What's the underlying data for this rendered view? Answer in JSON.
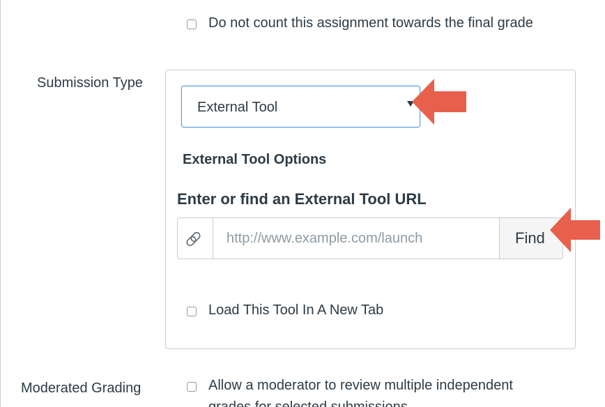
{
  "grading": {
    "exclude_final_grade_label": "Do not count this assignment towards the final grade"
  },
  "submission": {
    "label": "Submission Type",
    "selected_type": "External Tool",
    "options_heading": "External Tool Options",
    "url_heading": "Enter or find an External Tool URL",
    "url_placeholder": "http://www.example.com/launch",
    "find_label": "Find",
    "new_tab_label": "Load This Tool In A New Tab"
  },
  "moderated": {
    "label": "Moderated Grading",
    "line1": "Allow a moderator to review multiple independent",
    "line2": "grades for selected submissions"
  },
  "icons": {
    "url_addon": "link-icon",
    "select_caret": "caret-down-icon",
    "annotation": "arrow-left-icon"
  },
  "colors": {
    "annotation_arrow": "#e8604c",
    "focus_border": "#5aa0e6",
    "text": "#2d3b45"
  }
}
